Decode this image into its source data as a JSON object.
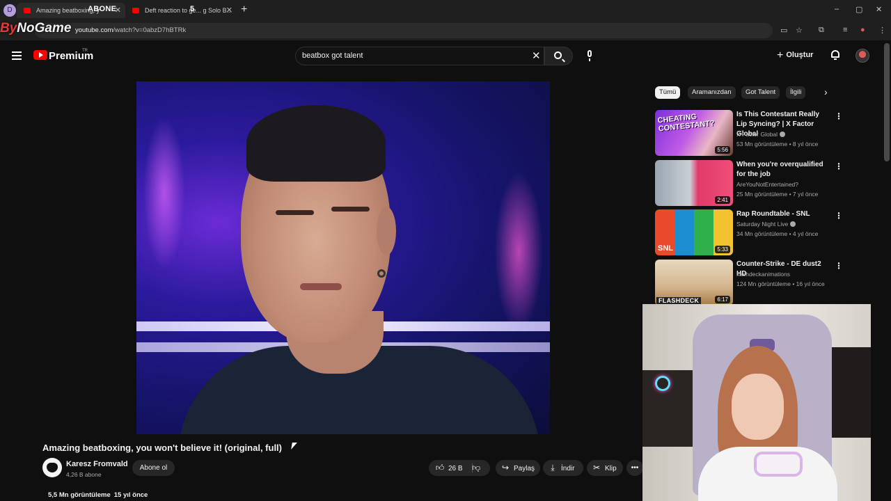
{
  "browser": {
    "profile_initial": "D",
    "tabs": [
      {
        "label": "Amazing beatboxing, y"
      },
      {
        "label": "Deft reaction to ge... g Solo B..."
      }
    ],
    "new_tab": "+",
    "url_prefix": "",
    "url_host": "youtube.com",
    "url_path": "/watch?v=0abzD7hBTRk",
    "window_controls": [
      "–",
      "▢",
      "✕"
    ]
  },
  "stream_overlay": {
    "abone_label": "ABONE",
    "five": "5",
    "logo_a": "By",
    "logo_b": "NoGame"
  },
  "header": {
    "brand": "Premium",
    "country": "TR",
    "search_value": "beatbox got talent",
    "create_label": "Oluştur"
  },
  "video": {
    "title": "Amazing beatboxing, you won't believe it! (original, full)",
    "channel": "Karesz Fromvald",
    "subscribers": "4,26 B abone",
    "subscribe_label": "Abone ol",
    "likes": "26 B",
    "share_label": "Paylaş",
    "download_label": "İndir",
    "clip_label": "Klip",
    "more_label": "•••",
    "views": "5,5 Mn görüntüleme",
    "age": "15 yıl önce"
  },
  "chips": [
    "Tümü",
    "Aramanızdan",
    "Got Talent",
    "İlgili"
  ],
  "recommendations": [
    {
      "title": "Is This Contestant Really Lip Syncing? | X Factor Global",
      "channel": "X Factor Global",
      "verified": true,
      "meta": "53 Mn görüntüleme • 8 yıl önce",
      "duration": "5:56",
      "thumb_caption": "CHEATING CONTESTANT?"
    },
    {
      "title": "When you're overqualified for the job",
      "channel": "AreYouNotEntertained?",
      "verified": false,
      "meta": "25 Mn görüntüleme • 7 yıl önce",
      "duration": "2:41",
      "thumb_caption": ""
    },
    {
      "title": "Rap Roundtable - SNL",
      "channel": "Saturday Night Live",
      "verified": true,
      "meta": "34 Mn görüntüleme • 4 yıl önce",
      "duration": "5:33",
      "thumb_caption": "SNL"
    },
    {
      "title": "Counter-Strike - DE dust2 HD",
      "channel": "flashdeckanimations",
      "verified": false,
      "meta": "124 Mn görüntüleme • 16 yıl önce",
      "duration": "6:17",
      "thumb_caption": "FLASHDECK"
    }
  ]
}
